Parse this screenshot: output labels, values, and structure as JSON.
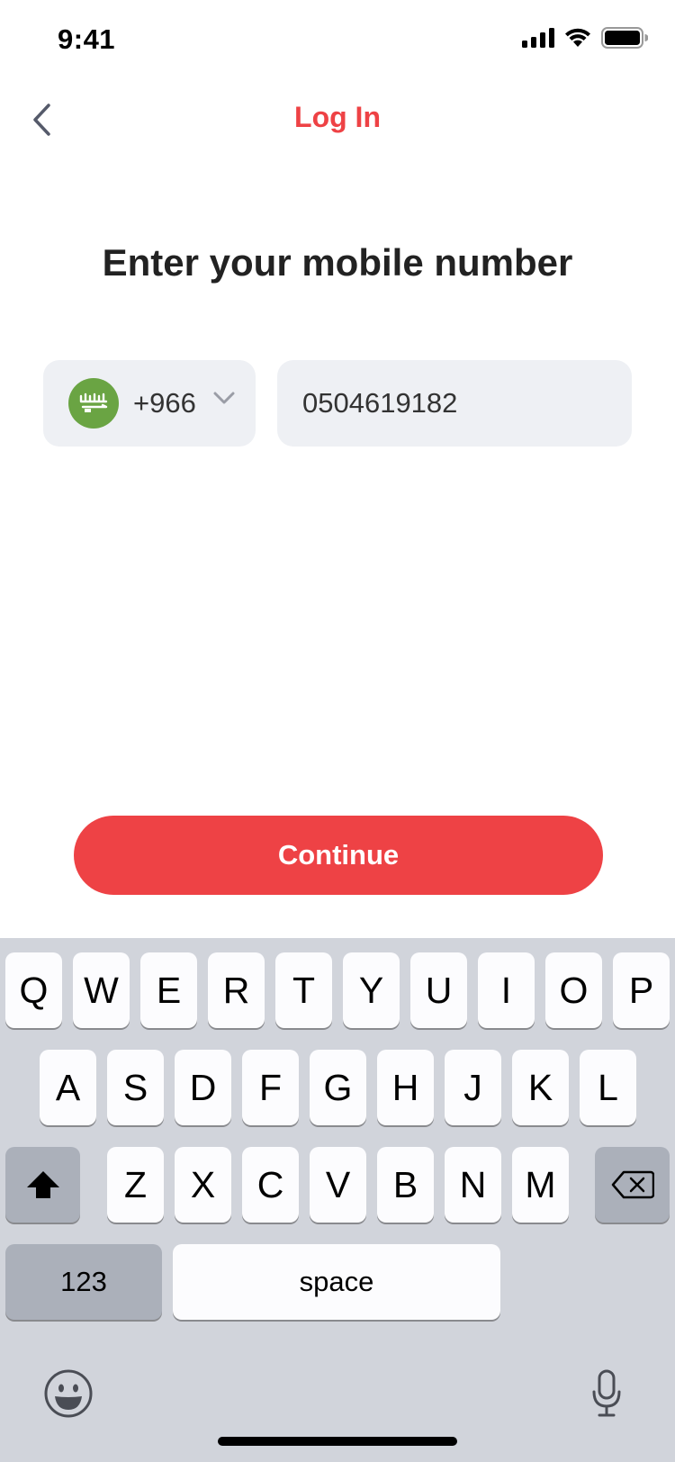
{
  "status_bar": {
    "time": "9:41"
  },
  "nav": {
    "title": "Log In",
    "back_icon": "chevron-left-icon"
  },
  "heading": "Enter your mobile number",
  "phone": {
    "country_flag": "saudi-arabia-flag-icon",
    "country_code": "+966",
    "number_value": "0504619182"
  },
  "continue_label": "Continue",
  "keyboard": {
    "row1": [
      "Q",
      "W",
      "E",
      "R",
      "T",
      "Y",
      "U",
      "I",
      "O",
      "P"
    ],
    "row2": [
      "A",
      "S",
      "D",
      "F",
      "G",
      "H",
      "J",
      "K",
      "L"
    ],
    "row3": [
      "Z",
      "X",
      "C",
      "V",
      "B",
      "N",
      "M"
    ],
    "numbers_label": "123",
    "space_label": "space",
    "shift_icon": "shift-icon",
    "delete_icon": "backspace-icon",
    "emoji_icon": "emoji-icon",
    "mic_icon": "microphone-icon"
  },
  "colors": {
    "accent": "#ee4245",
    "field_bg": "#eef0f4",
    "flag_green": "#6aa443",
    "keyboard_bg": "#d1d4db"
  }
}
